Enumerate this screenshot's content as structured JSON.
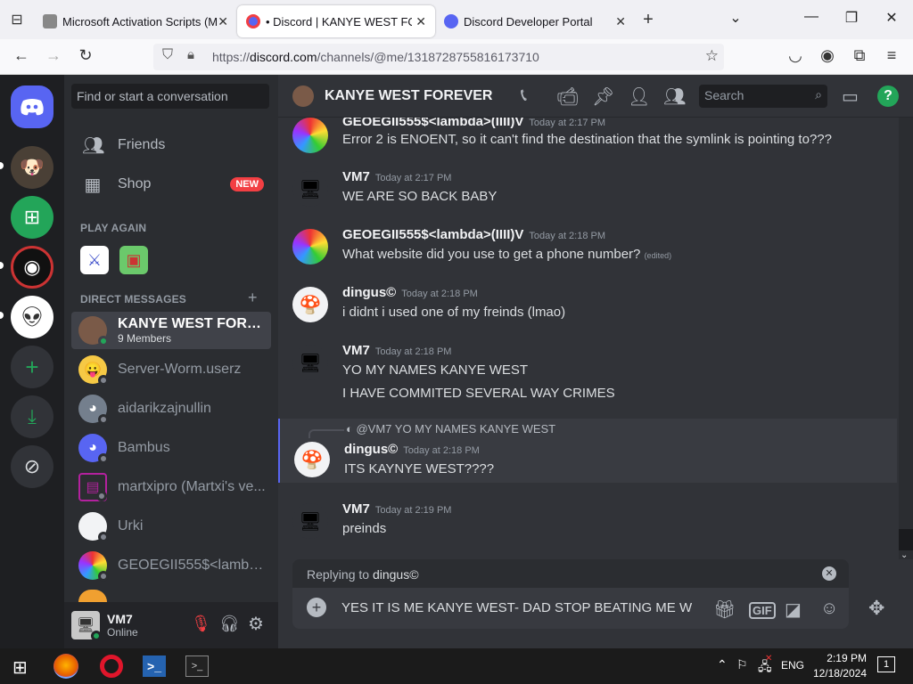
{
  "browser": {
    "tabs": [
      {
        "title": "Microsoft Activation Scripts (M",
        "active": false
      },
      {
        "title": "• Discord | KANYE WEST FOREV",
        "active": true
      },
      {
        "title": "Discord Developer Portal",
        "active": false
      }
    ],
    "url_prefix": "https://",
    "url_domain": "discord.com",
    "url_path": "/channels/@me/1318728755816173710"
  },
  "sidebar": {
    "search_placeholder": "Find or start a conversation",
    "friends_label": "Friends",
    "shop_label": "Shop",
    "shop_badge": "NEW",
    "play_again_header": "PLAY AGAIN",
    "dm_header": "DIRECT MESSAGES",
    "dms": [
      {
        "name": "KANYE WEST FOREV...",
        "sub": "9 Members",
        "selected": true,
        "avatar_color": "#7a5a48"
      },
      {
        "name": "Server-Worm.userz",
        "sub": "",
        "selected": false,
        "avatar_color": "#f6c945"
      },
      {
        "name": "aidarikzajnullin",
        "sub": "",
        "selected": false,
        "avatar_color": "#747f8d"
      },
      {
        "name": "Bambus",
        "sub": "",
        "selected": false,
        "avatar_color": "#5865f2"
      },
      {
        "name": "martxipro (Martxi's ve...",
        "sub": "",
        "selected": false,
        "avatar_color": "#b3219e"
      },
      {
        "name": "Urki",
        "sub": "",
        "selected": false,
        "avatar_color": "#ffffff"
      },
      {
        "name": "GEOEGII555$<lambd...",
        "sub": "",
        "selected": false,
        "avatar_color": "#2fb44a"
      }
    ]
  },
  "user": {
    "name": "VM7",
    "status": "Online"
  },
  "channel": {
    "title": "KANYE WEST FOREVER",
    "search_placeholder": "Search"
  },
  "messages": [
    {
      "author": "GEOEGII555$<lambda>(IIII)V",
      "time": "Today at 2:17 PM",
      "lines": [
        "Error 2 is ENOENT, so it can't find the destination that the symlink is pointing to???"
      ],
      "edited": "",
      "avatar": "rainbow"
    },
    {
      "author": "VM7",
      "time": "Today at 2:17 PM",
      "lines": [
        "WE ARE SO BACK BABY"
      ],
      "edited": "",
      "avatar": "vm"
    },
    {
      "author": "GEOEGII555$<lambda>(IIII)V",
      "time": "Today at 2:18 PM",
      "lines": [
        "What website did you use to get a phone number?"
      ],
      "edited": "(edited)",
      "avatar": "rainbow"
    },
    {
      "author": "dingus©",
      "time": "Today at 2:18 PM",
      "lines": [
        "i didnt i used one of my freinds (lmao)"
      ],
      "edited": "",
      "avatar": "toad"
    },
    {
      "author": "VM7",
      "time": "Today at 2:18 PM",
      "lines": [
        "YO MY NAMES KANYE WEST",
        "I HAVE COMMITED SEVERAL WAY CRIMES"
      ],
      "edited": "",
      "avatar": "vm"
    },
    {
      "author": "dingus©",
      "time": "Today at 2:18 PM",
      "lines": [
        "ITS KAYNYE WEST????"
      ],
      "edited": "",
      "avatar": "toad",
      "reply_to": "@VM7 YO MY NAMES KANYE WEST"
    },
    {
      "author": "VM7",
      "time": "Today at 2:19 PM",
      "lines": [
        "preinds"
      ],
      "edited": "",
      "avatar": "vm"
    }
  ],
  "composer": {
    "replying_prefix": "Replying to ",
    "replying_name": "dingus©",
    "value": "YES IT IS ME KANYE WEST- DAD STOP BEATING ME W"
  },
  "taskbar": {
    "language": "ENG",
    "time": "2:19 PM",
    "date": "12/18/2024",
    "notifications": "1"
  },
  "colors": {
    "blurple": "#5865f2",
    "green": "#23a559",
    "red": "#f23f43",
    "bg": "#313338"
  }
}
